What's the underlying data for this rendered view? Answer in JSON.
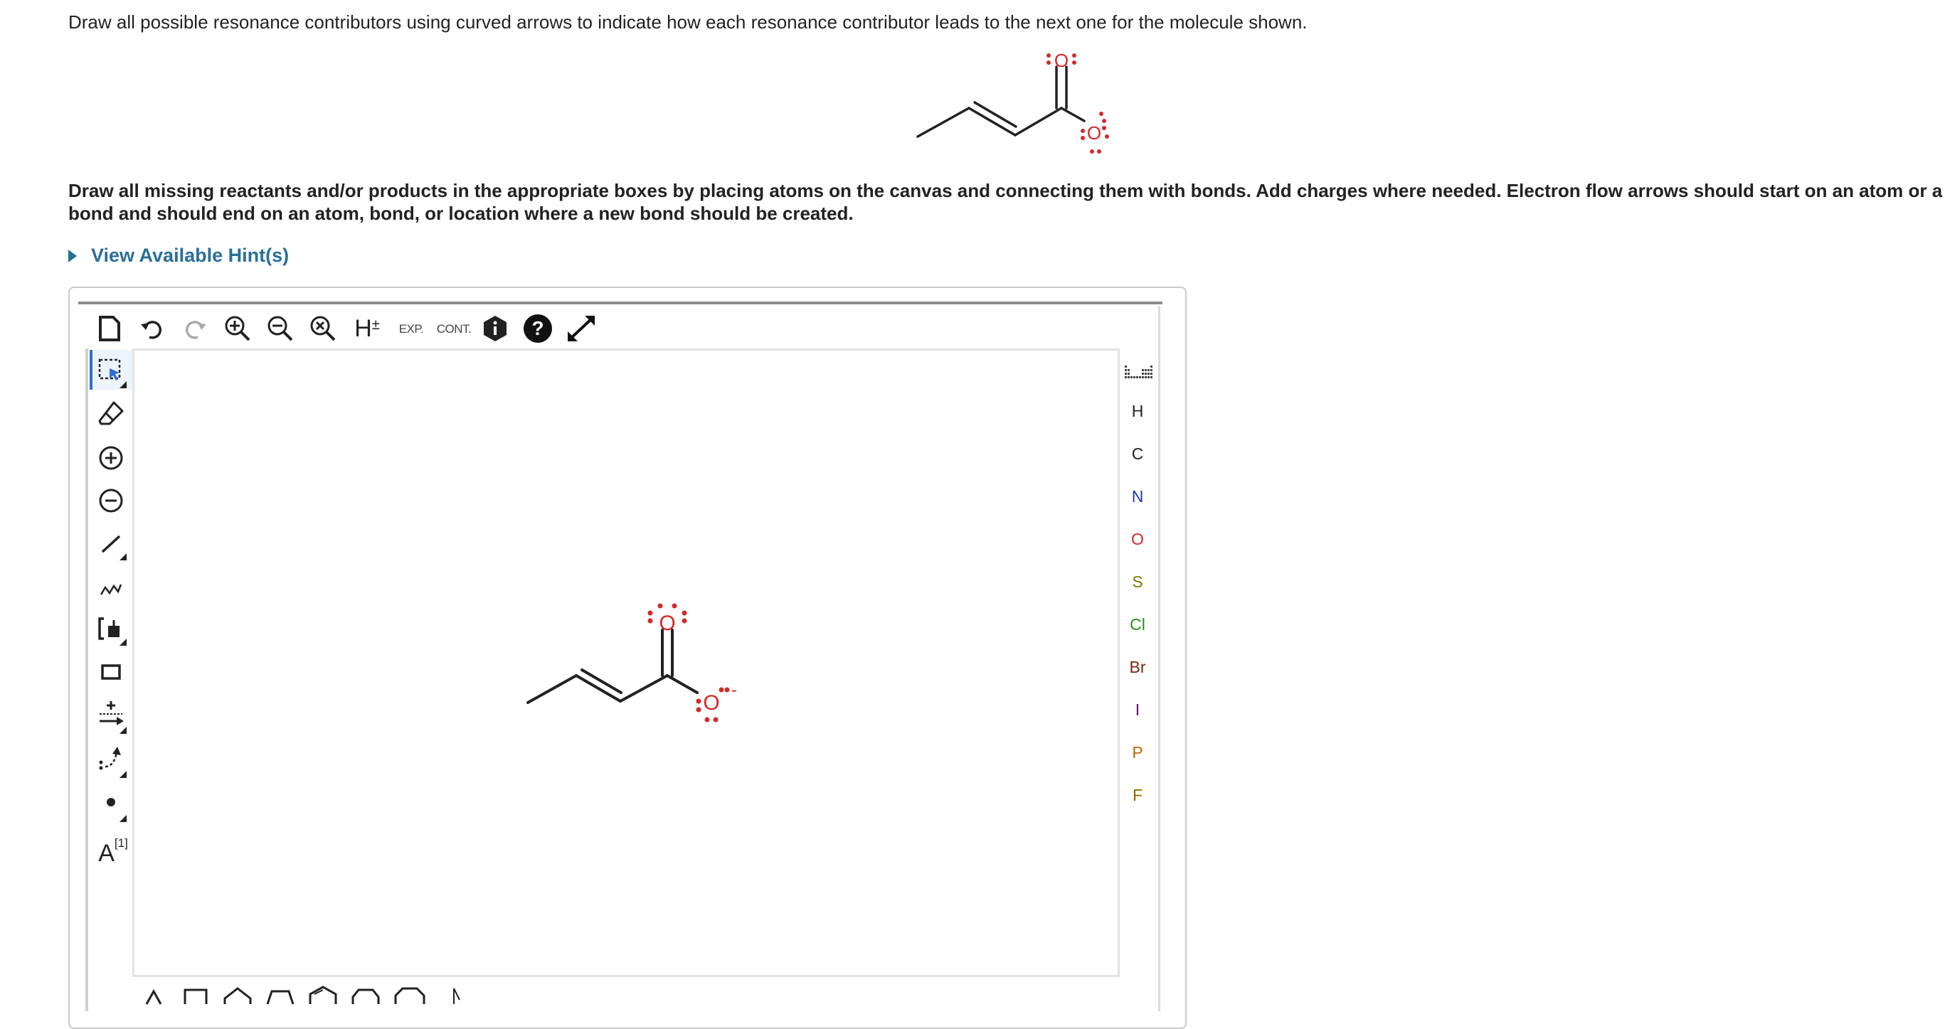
{
  "question": {
    "prompt": "Draw all possible resonance contributors using curved arrows to indicate how each resonance contributor leads to the next one for the molecule shown.",
    "instructions": "Draw all missing reactants and/or products in the appropriate boxes by placing atoms on the canvas and connecting them with bonds. Add charges where needed. Electron flow arrows should start on an atom or a bond and should end on an atom, bond, or location where a new bond should be created.",
    "hint_label": "View Available Hint(s)"
  },
  "molecule": {
    "carbonyl_oxygen": "O",
    "anionic_oxygen": "O",
    "charge": "-"
  },
  "toolbar": {
    "exp_label": "EXP.",
    "cont_label": "CONT.",
    "h_label": "H",
    "h_sup": "±"
  },
  "left_tools": {
    "text_tool_label": "A",
    "text_tool_sup": "[1]"
  },
  "elements": [
    {
      "symbol": "H",
      "color": "#222222"
    },
    {
      "symbol": "C",
      "color": "#222222"
    },
    {
      "symbol": "N",
      "color": "#1f3a9e"
    },
    {
      "symbol": "O",
      "color": "#d62828"
    },
    {
      "symbol": "S",
      "color": "#7a7a00"
    },
    {
      "symbol": "Cl",
      "color": "#2c8a1e"
    },
    {
      "symbol": "Br",
      "color": "#7a2a10"
    },
    {
      "symbol": "I",
      "color": "#5a1a6a"
    },
    {
      "symbol": "P",
      "color": "#b86a00"
    },
    {
      "symbol": "F",
      "color": "#8a6a00"
    }
  ],
  "colors": {
    "accent": "#2a6f97",
    "oxygen": "#d62828",
    "selection": "#2f6fd0"
  }
}
